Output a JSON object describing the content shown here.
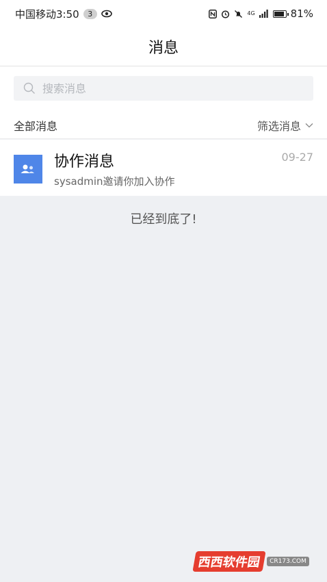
{
  "status_bar": {
    "carrier_time": "中国移动3:50",
    "badge": "3",
    "battery": "81%",
    "network": "4G"
  },
  "header": {
    "title": "消息"
  },
  "search": {
    "placeholder": "搜索消息"
  },
  "filter": {
    "left_label": "全部消息",
    "right_label": "筛选消息"
  },
  "messages": [
    {
      "title": "协作消息",
      "subtitle": "sysadmin邀请你加入协作",
      "date": "09-27",
      "icon": "users-icon",
      "color": "#4f86e8"
    }
  ],
  "footer": {
    "end_text": "已经到底了!"
  },
  "watermark": {
    "text": "西西软件园",
    "sub": "CR173.COM"
  }
}
